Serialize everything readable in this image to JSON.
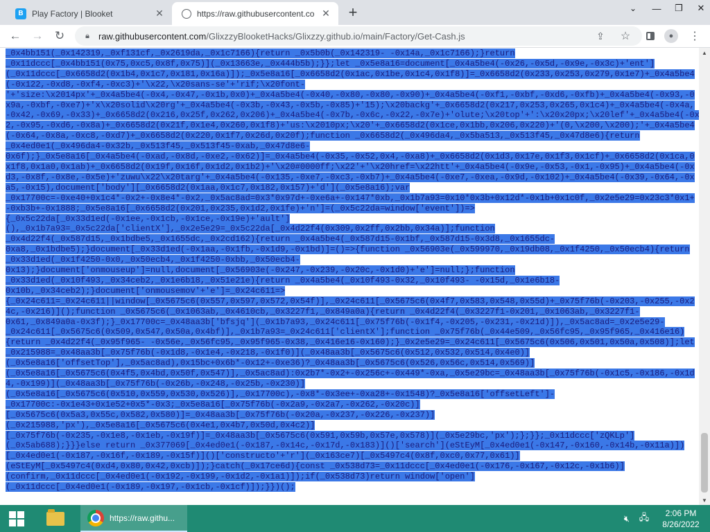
{
  "browser": {
    "tabs": [
      {
        "title": "Play Factory | Blooket",
        "favicon": "blooket-icon",
        "active": false
      },
      {
        "title": "https://raw.githubusercontent.co",
        "favicon": "globe-icon",
        "active": true
      }
    ],
    "new_tab_symbol": "+",
    "url": {
      "host": "raw.githubusercontent.com",
      "path": "/GlixzzyBlooketHacks/Glixzzy.github.io/main/Factory/Get-Cash.js"
    }
  },
  "code_lines": [
    "_0x4bb151(_0x142319,_0xf131cf,_0x2619da,_0x1c7166){return _0x5b0b(_0x142319- -0x14a,_0x1c7166);}return",
    "_0x11dccc[_0x4bb151(0x75,0xc5,0x8f,0x75)](_0x13663e,_0x444b5b);}};let _0x5e8a16=document[_0x4a5be4(-0x26,-0x5d,-0x9e,-0x3c)+'ent']",
    "(_0x11dccc[_0x6658d2(0x1b4,0x1c7,0x181,0x16a)]);_0x5e8a16[_0x6658d2(0x1ac,0x1be,0x1c4,0x1f8)]=_0x6658d2(0x233,0x253,0x279,0x1e7)+_0x4a5be4",
    "(-0x122,-0xd8,-0xf4,-0xc3)+'\\x22,\\x20sans-se'+'rif;\\x20font-",
    "'+'size:\\x2014px'+_0x4a5be4(-0x4,-0x47,-0x1b,0x0)+_0x4a5be4(-0x40,-0x80,-0x80,-0x90)+_0x4a5be4(-0xf1,-0xbf,-0xd6,-0xfb)+_0x4a5be4(-0x93,-0",
    "x9a,-0xbf,-0xe7)+'x\\x20solid\\x20rg'+_0x4a5be4(-0x3b,-0x43,-0x5b,-0x85)+'15);\\x20backg'+_0x6658d2(0x217,0x253,0x265,0x1c4)+_0x4a5be4(-0x4a,",
    "-0x42,-0x69,-0x33)+_0x6658d2(0x216,0x25f,0x262,0x206)+_0x4a5be4(-0x7b,-0x6c,-0x22,-0x7e)+'olute;\\x20top'+':\\x20x20px;\\x20lef'+_0x4a5be4(-0xd",
    "2,-0x95,-0xd6,-0x8a)+_0x6658d2(0x21f,0x1e4,0x260,0x1f8)+'us:\\x2010px;\\x20'+_0x6658d2(0x1ce,0x1bb,0x206,0x220)+'(0,\\x200,\\x200);'+_0x4a5be4",
    "(-0x64,-0x8a,-0xc8,-0xd7)+_0x6658d2(0x220,0x1f7,0x26d,0x20f);function _0x6658d2(_0x496da4,_0x5ba513,_0x513f45,_0x47d8e6){return",
    "_0x4ed0e1(_0x496da4-0x32b,_0x513f45,_0x513f45-0xab,_0x47d8e6-",
    "0x6f);}_0x5e8a16[_0x4a5be4(-0xad,-0x8d,-0xe2,-0x62)]=_0x4a5be4(-0x35,-0x52,0x4,-0xa8)+_0x6658d2(0x1d3,0x17e,0x1f3,0x1cf)+_0x6658d2(0x1ca,0",
    "x1f8,0x1a0,0x1ab)+_0x6658d2(0x19f,0x16f,0x1d2,0x1b2)+'\\x20#0000ff;\\x22'+'\\x20href=\\x22htt'+_0x4a5be4(-0x9e,-0x53,-0x1,-0x95)+_0x4a5be4(-0x",
    "d3,-0x8f,-0x8e,-0x5e)+'zuwu\\x22\\x20targ'+_0x4a5be4(-0x135,-0xe7,-0xc3,-0xb7)+_0x4a5be4(-0xe7,-0xea,-0x9d,-0x102)+_0x4a5be4(-0x39,-0x64,-0x",
    "a5,-0x15),document['body'][_0x6658d2(0x1aa,0x1c7,0x182,0x157)+'d'](_0x5e8a16);var",
    "_0x17700c=-0xe40+0x1c4*-0x2+-0x8e4*-0x2,_0x5ac8ad=0x3*0x97d+-0xe6a+-0x147*0xb,_0x1b7a93=0x10*0x3b+0x12d*-0x1b+0x1c0f,_0x2e5e29=0x23c3*0x1+",
    "-0xb3b+-0x1888;_0x5e8a16[_0x6658d2(0x201,0x235,0x1d2,0x1fe)+'n']=(_0x5c22da=window['event'])=>",
    "{_0x5c22da[_0x33d1ed(-0x1ee,-0x1cb,-0x1ce,-0x19e)+'ault']",
    "(),_0x1b7a93=_0x5c22da['clientX'],_0x2e5e29=_0x5c22da[_0x4d22f4(0x309,0x2ff,0x2bb,0x34a)];function",
    "_0x4d22f4(_0x587d15,_0x1bdbe5,_0x1655dc,_0x2cd162){return _0x4a5be4(_0x587d15-0x1bf,_0x587d15-0x3d8,_0x1655dc-",
    "0xa8,_0x1bdbe5);}document[_0x33d1ed(-0x1aa,-0x1fb,-0x1d9,-0x1bd)]=()=>{function _0x56903e(_0x599970,_0x19db08,_0x1f4250,_0x50ecb4){return",
    "_0x33d1ed(_0x1f4250-0x0,_0x50ecb4,_0x1f4250-0xbb,_0x50ecb4-",
    "0x13);}document['onmouseup']=null,document[_0x56903e(-0x247,-0x239,-0x20c,-0x1d0)+'e']=null;};function",
    "_0x33d1ed(_0x10f493,_0x34ceb2,_0x1e6b18,_0x51e21e){return _0x4a5be4(_0x10f493-0x32,_0x10f493- -0x15d,_0x1e6b18-",
    "0x10b,_0x34ceb2);}document['onmousemov'+'e']=_0x24c611=>",
    "{_0x24c611=_0x24c611||window[_0x5675c6(0x557,0x597,0x572,0x54f)],_0x24c611[_0x5675c6(0x4f7,0x583,0x548,0x55d)+_0x75f76b(-0x203,-0x255,-0x2",
    "4c,-0x216)]();function _0x5675c6(_0x1063ab,_0x4610cb,_0x3227f1,_0x849a0a){return _0x4d22f4(_0x3227f1-0x201,_0x1063ab,_0x3227f1-",
    "0x61,_0x849a0a-0x3f);}_0x17700c=_0x48aa3b['bfsjq'](_0x1b7a93,_0x24c611[_0x75f76b(-0x1f4,-0x205,-0x231,-0x21d)]),_0x5ac8ad=_0x2e5e29-",
    "_0x24c611[_0x5675c6(0x509,0x547,0x50a,0x4bf)],_0x1b7a93=_0x24c611['clientX'];function _0x75f76b(_0x44e509,_0x56fc95,_0x95f965,_0x416e16)",
    "{return _0x4d22f4(_0x95f965- -0x56e,_0x56fc95,_0x95f965-0x38,_0x416e16-0x160);}_0x2e5e29=_0x24c611[_0x5675c6(0x506,0x501,0x50a,0x508)];let",
    "_0x215988=_0x48aa3b[_0x75f76b(-0x1d8,-0x1e4,-0x218,-0x1f0)](_0x48aa3b[_0x5675c6(0x512,0x532,0x514,0x4e0)]",
    "(_0x5e8a16['offsetTop'],_0x5ac8ad),0x15bc+0x6b*-0x12+-0xe36)?_0x48aa3b[_0x5675c6(0x526,0x56c,0x514,0x569)]",
    "(_0x5e8a16[_0x5675c6(0x4f5,0x4bd,0x50f,0x547)],_0x5ac8ad):0x2b7*-0x2+-0x256c+-0x449*-0xa,_0x5e29bc=_0x48aa3b[_0x75f76b(-0x1c5,-0x186,-0x1d",
    "4,-0x199)](_0x48aa3b[_0x75f76b(-0x26b,-0x248,-0x25b,-0x230)]",
    "(_0x5e8a16[_0x5675c6(0x510,0x559,0x530,0x526)],_0x17700c),-0x8*-0x3ee+-0xa28+-0x1548)?_0x5e8a16['offsetLeft']-",
    "_0x17700c:-0x1e43+0x1e52+0x5*-0x3;_0x5e8a16[_0x75f76b(-0x2a9,-0x2a7,-0x262,-0x20c)]",
    "[_0x5675c6(0x5a3,0x55c,0x582,0x580)]=_0x48aa3b[_0x75f76b(-0x20a,-0x237,-0x226,-0x237)]",
    "(_0x215988,'px'),_0x5e8a16[_0x5675c6(0x4e1,0x4b7,0x50d,0x4c2)]",
    "[_0x75f76b(-0x235,-0x1e8,-0x1eb,-0x19f)]=_0x48aa3b[_0x5675c6(0x591,0x59b,0x57e,0x578)](_0x5e29bc,'px');};}};_0x11dccc['zQKLp']",
    "(_0x5ab688);}}}else return _0x377069[_0x4ed0e1(-0x187,-0x14c,-0x17d,-0x183)]()['search'](eStEyM[_0x4ed0e1(-0x147,-0x160,-0x14b,-0x11a)])",
    "[_0x4ed0e1(-0x187,-0x16f,-0x189,-0x15f)]()['constructo'+'r'](_0x163ce7)[_0x5497c4(0x8f,0xc0,0x77,0x61)]",
    "(eStEyM[_0x5497c4(0xd4,0x80,0x42,0xcb)]);}catch(_0x17ce6d){const _0x538d73=_0x11dccc[_0x4ed0e1(-0x176,-0x167,-0x12c,-0x1b6)]",
    "(confirm,_0x11dccc[_0x4ed0e1(-0x192,-0x199,-0x1d2,-0x1a1)]);if(_0x538d73)return window['open']",
    "(_0x11dccc[_0x4ed0e1(-0x189,-0x197,-0x1cb,-0x1cf)]);}})();"
  ],
  "taskbar": {
    "chrome_label": "https://raw.githu...",
    "time": "2:06 PM",
    "date": "8/26/2022"
  },
  "colors": {
    "selection": "#3b78e7",
    "code_text": "#1a1a8a",
    "taskbar": "#1f8a73"
  }
}
